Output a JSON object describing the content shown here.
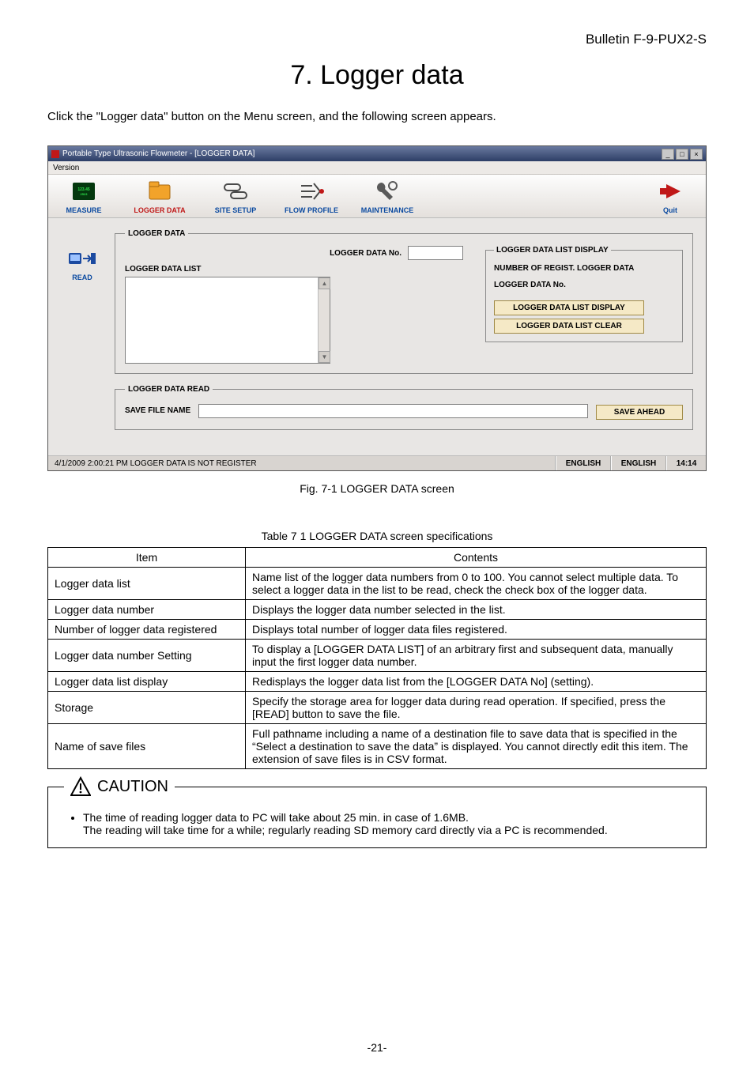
{
  "bulletin": "Bulletin F-9-PUX2-S",
  "section_title": "7. Logger data",
  "intro": "Click the \"Logger data\" button on the Menu screen, and the following screen appears.",
  "app": {
    "title": "Portable Type Ultrasonic Flowmeter - [LOGGER DATA]",
    "menu_version": "Version",
    "toolbar": {
      "measure": "MEASURE",
      "logger_data": "LOGGER DATA",
      "site_setup": "SITE SETUP",
      "flow_profile": "FLOW PROFILE",
      "maintenance": "MAINTENANCE",
      "quit": "Quit"
    },
    "side": {
      "read": "READ"
    },
    "group_logger_data": {
      "legend": "LOGGER DATA",
      "list_label": "LOGGER DATA LIST",
      "logger_no_label": "LOGGER DATA No.",
      "logger_no_value": ""
    },
    "group_list_display": {
      "legend": "LOGGER DATA LIST DISPLAY",
      "num_regist": "NUMBER OF REGIST. LOGGER DATA",
      "logger_no_label": "LOGGER DATA No.",
      "btn_display": "LOGGER DATA LIST DISPLAY",
      "btn_clear": "LOGGER DATA LIST CLEAR"
    },
    "group_read": {
      "legend": "LOGGER DATA READ",
      "save_file_label": "SAVE FILE NAME",
      "save_file_value": "",
      "btn_save_ahead": "SAVE AHEAD"
    },
    "status": {
      "left": "4/1/2009 2:00:21 PM LOGGER DATA IS NOT REGISTER",
      "lang1": "ENGLISH",
      "lang2": "ENGLISH",
      "time": "14:14"
    }
  },
  "fig_caption": "Fig. 7-1 LOGGER DATA screen",
  "table_caption": "Table 7   1 LOGGER DATA screen specifications",
  "table": {
    "head_item": "Item",
    "head_contents": "Contents",
    "rows": [
      {
        "item": "Logger data list",
        "contents": "Name list of the logger data numbers from 0 to 100. You cannot select multiple data. To select a logger data in the list to be read, check the check box of the logger data."
      },
      {
        "item": "Logger data number",
        "contents": "Displays the logger data number selected in the list."
      },
      {
        "item": "Number of logger data registered",
        "contents": "Displays total number of logger data files registered."
      },
      {
        "item": "Logger data number Setting",
        "contents": "To display a [LOGGER DATA LIST] of an arbitrary first and subsequent data, manually input the first logger data number."
      },
      {
        "item": "Logger data list display",
        "contents": "Redisplays the logger data list from the [LOGGER DATA No] (setting)."
      },
      {
        "item": "Storage",
        "contents": "Specify the storage area for logger data during read operation. If specified, press the [READ] button to save the file."
      },
      {
        "item": "Name of save files",
        "contents": "Full pathname including a name of a destination file to save data that is specified in the “Select a destination to save the data” is displayed. You cannot directly edit this item. The extension of save files is in CSV format."
      }
    ]
  },
  "caution": {
    "title": "CAUTION",
    "bullet1": "The time of reading logger data to PC will take about 25 min. in case of 1.6MB.",
    "bullet2": "The reading will take time for a while; regularly reading SD memory card directly via a PC is recommended."
  },
  "page_number": "-21-"
}
